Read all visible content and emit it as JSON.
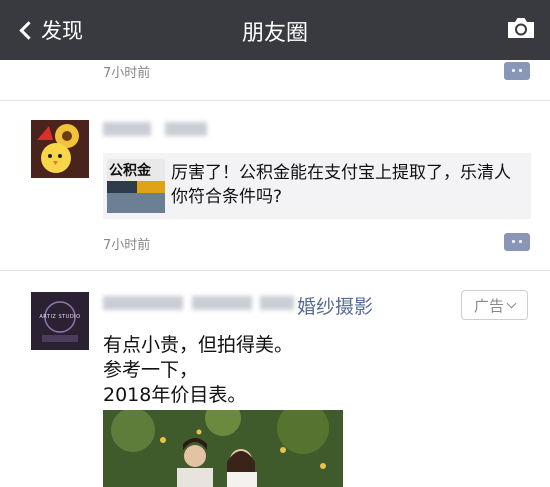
{
  "navbar": {
    "back_label": "发现",
    "title": "朋友圈",
    "camera_icon": "camera-icon"
  },
  "post_prev": {
    "time": "7小时前"
  },
  "post_share": {
    "share_text": "厉害了！公积金能在支付宝上提取了，乐清人你符合条件吗?",
    "thumb_text": "公积金",
    "time": "7小时前"
  },
  "post_ad": {
    "name_suffix": "婚纱摄影",
    "ad_label": "广告",
    "avatar_text": "ARTIZ STUDIO",
    "lines": [
      "有点小贵，但拍得美。",
      "参考一下，",
      "2018年价目表。"
    ]
  },
  "colors": {
    "navbar": "#393a3f",
    "link": "#576b95",
    "comment_button": "#8a96b8"
  }
}
